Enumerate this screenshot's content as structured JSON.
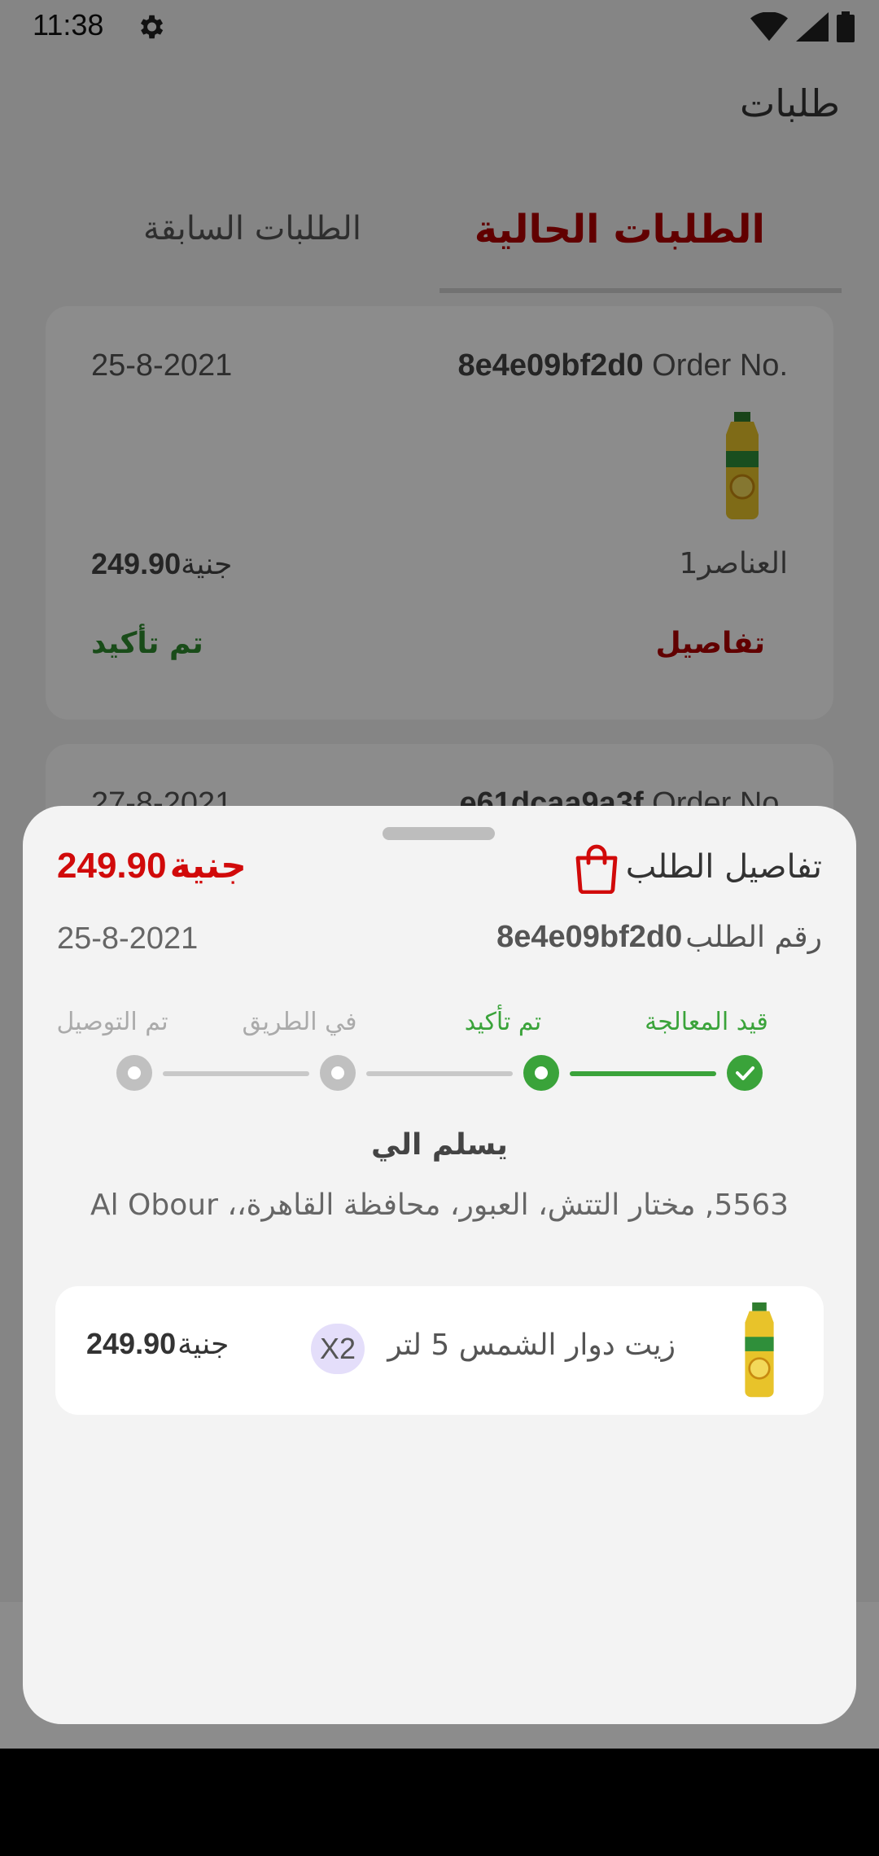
{
  "status_bar": {
    "time": "11:38"
  },
  "page": {
    "title": "طلبات"
  },
  "tabs": {
    "current": "الطلبات الحالية",
    "previous": "الطلبات السابقة"
  },
  "orders": [
    {
      "order_no_label": "Order No.",
      "order_no": "8e4e09bf2d0",
      "date": "25-8-2021",
      "items_count": "1",
      "items_label": "العناصر",
      "price": "249.90",
      "currency": "جنية",
      "details": "تفاصيل",
      "status": "تم تأكيد"
    },
    {
      "order_no_label": "Order No.",
      "order_no": "e61dcaa9a3f",
      "date": "27-8-2021"
    }
  ],
  "sheet": {
    "title": "تفاصيل الطلب",
    "total": "249.90",
    "currency": "جنية",
    "order_no_label": "رقم الطلب",
    "order_no": "8e4e09bf2d0",
    "date": "25-8-2021",
    "steps": [
      {
        "label": "قيد المعالجة",
        "state": "done"
      },
      {
        "label": "تم تأكيد",
        "state": "active"
      },
      {
        "label": "في الطريق",
        "state": "pending"
      },
      {
        "label": "تم التوصيل",
        "state": "pending"
      }
    ],
    "deliver_to_label": "يسلم الي",
    "address": "5563, مختار التتش، العبور، محافظة القاهرة،، Al Obour",
    "items": [
      {
        "name": "زيت دوار الشمس 5 لتر",
        "qty": "X2",
        "price": "249.90",
        "currency": "جنية"
      }
    ]
  },
  "colors": {
    "brand_red": "#b10000",
    "price_red": "#d10a0a",
    "status_green": "#3aa33a"
  },
  "icons": {
    "settings": "gear-icon",
    "bag": "shopping-bag-icon",
    "check": "check-icon"
  }
}
